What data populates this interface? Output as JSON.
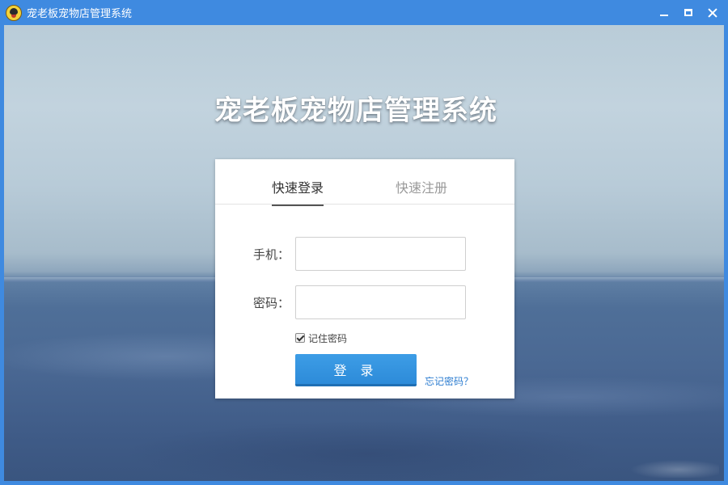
{
  "window": {
    "title": "宠老板宠物店管理系统",
    "colors": {
      "titlebar": "#3f8ae0",
      "accent": "#2d8bd9",
      "link": "#2b7cd0"
    },
    "icons": [
      "app-logo-icon",
      "minimize-icon",
      "maximize-icon",
      "close-icon"
    ]
  },
  "main": {
    "heading": "宠老板宠物店管理系统"
  },
  "login_card": {
    "tabs": [
      {
        "label": "快速登录",
        "active": true
      },
      {
        "label": "快速注册",
        "active": false
      }
    ],
    "phone": {
      "label": "手机：",
      "value": "",
      "placeholder": ""
    },
    "password": {
      "label": "密码：",
      "value": "",
      "placeholder": ""
    },
    "remember": {
      "label": "记住密码",
      "checked": true
    },
    "login_button": "登 录",
    "forgot_link": "忘记密码？"
  }
}
